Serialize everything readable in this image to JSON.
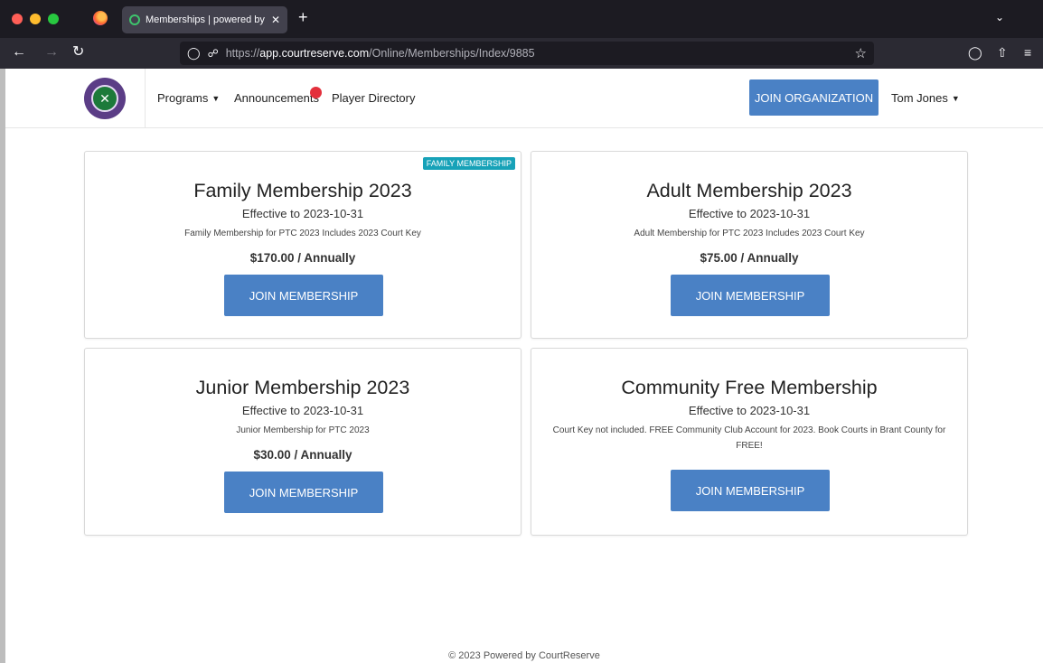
{
  "browser": {
    "tab_title": "Memberships | powered by CourtReserve",
    "tab_close": "✕",
    "new_tab": "+",
    "url_host": "app.courtreserve.com",
    "url_path": "/Online/Memberships/Index/9885",
    "url_scheme": "https://"
  },
  "site_nav": {
    "programs_label": "Programs",
    "announcements_label": "Announcements",
    "player_directory_label": "Player Directory",
    "join_org_label": "JOIN ORGANIZATION",
    "user_label": "Tom Jones"
  },
  "memberships": [
    {
      "title": "Family Membership 2023",
      "effective": "Effective to 2023-10-31",
      "description": "Family Membership for PTC 2023 Includes 2023 Court Key",
      "price": "$170.00 / Annually",
      "badge": "FAMILY MEMBERSHIP",
      "button": "JOIN MEMBERSHIP"
    },
    {
      "title": "Adult Membership 2023",
      "effective": "Effective to 2023-10-31",
      "description": "Adult Membership for PTC 2023 Includes 2023 Court Key",
      "price": "$75.00 / Annually",
      "button": "JOIN MEMBERSHIP"
    },
    {
      "title": "Junior Membership 2023",
      "effective": "Effective to 2023-10-31",
      "description": "Junior Membership for PTC 2023",
      "price": "$30.00 / Annually",
      "button": "JOIN MEMBERSHIP"
    },
    {
      "title": "Community Free Membership",
      "effective": "Effective to 2023-10-31",
      "description": "Court Key not included. FREE Community Club Account for 2023. Book Courts in Brant County for FREE!",
      "button": "JOIN MEMBERSHIP"
    }
  ],
  "footer": "© 2023 Powered by CourtReserve",
  "colors": {
    "primary_button": "#4a81c5",
    "badge": "#17a2b8",
    "notification": "#e3303c"
  }
}
